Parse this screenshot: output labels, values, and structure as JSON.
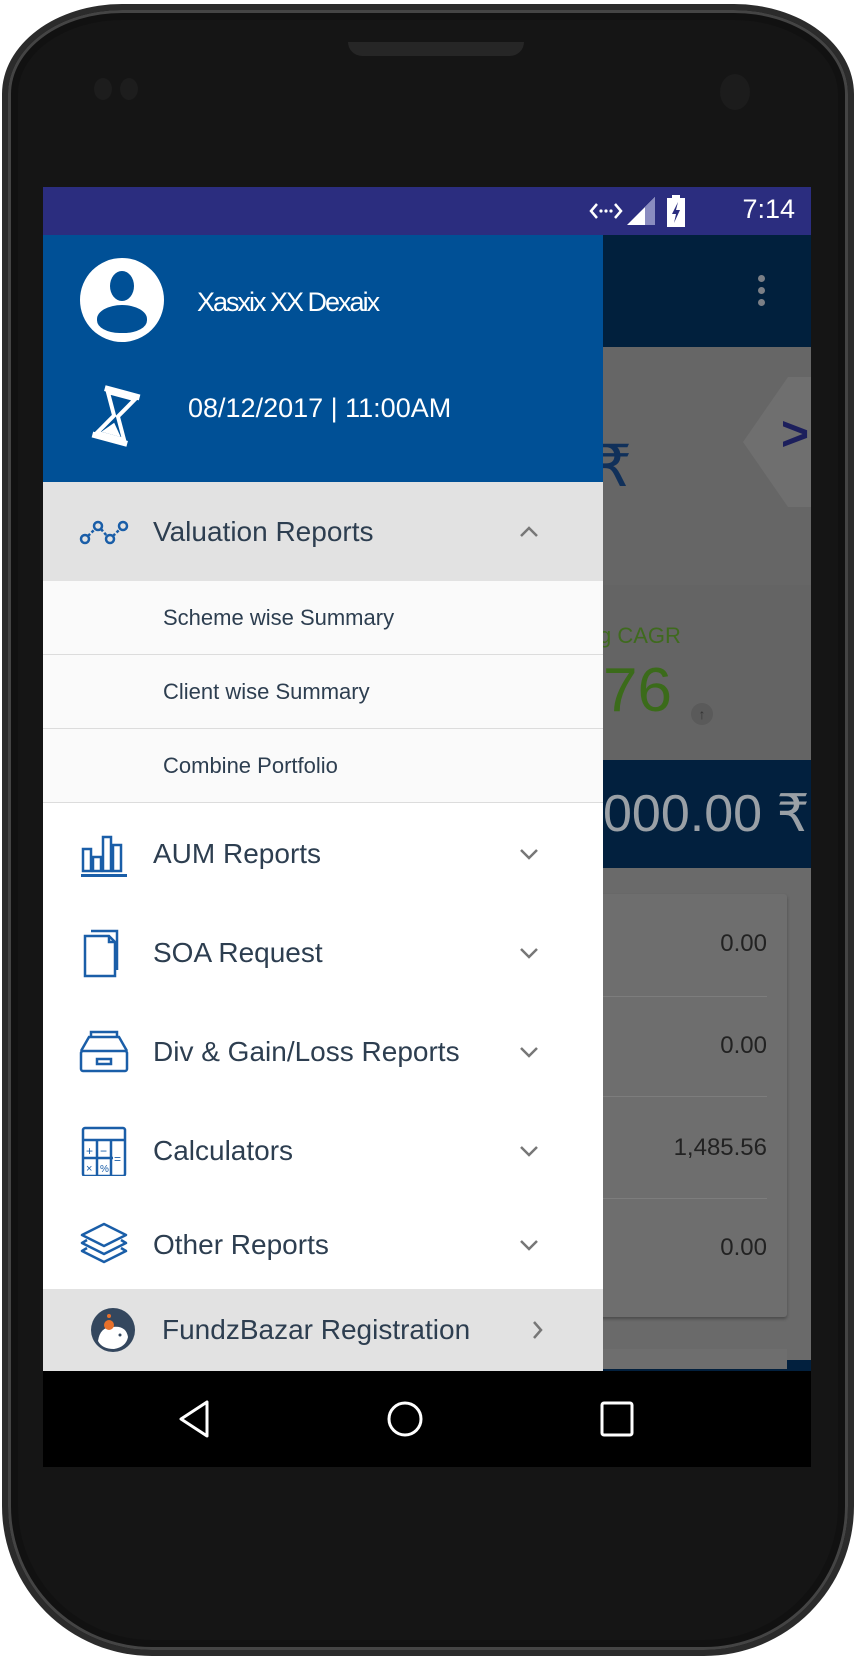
{
  "status_bar": {
    "time": "7:14",
    "icons": [
      "code-brackets-icon",
      "signal-icon",
      "battery-charging-icon"
    ]
  },
  "drawer": {
    "user_name": "Xasxix XX Dexaix",
    "last_login": "08/12/2017 | 11:00AM",
    "menu": [
      {
        "label": "Valuation Reports",
        "icon": "line-chart-icon",
        "expanded": true,
        "children": [
          "Scheme wise Summary",
          "Client wise Summary",
          "Combine Portfolio"
        ]
      },
      {
        "label": "AUM Reports",
        "icon": "bar-chart-icon"
      },
      {
        "label": "SOA Request",
        "icon": "documents-icon"
      },
      {
        "label": "Div & Gain/Loss Reports",
        "icon": "archive-tray-icon"
      },
      {
        "label": "Calculators",
        "icon": "calculator-icon"
      },
      {
        "label": "Other Reports",
        "icon": "layers-icon"
      },
      {
        "label": "FundzBazar Registration",
        "icon": "fundzbazar-logo-icon"
      }
    ]
  },
  "background": {
    "currency": "₹",
    "cagr_label": "g CAGR",
    "cagr_value": "76",
    "total_value": "000.00 ₹",
    "rows": [
      "0.00",
      "0.00",
      "1,485.56",
      "0.00"
    ]
  },
  "colors": {
    "status_bar": "#2b2d7f",
    "drawer_header": "#005096",
    "icon_blue": "#1a5ea8",
    "text": "#2d3e50",
    "cagr_green": "#3b6b1a"
  }
}
